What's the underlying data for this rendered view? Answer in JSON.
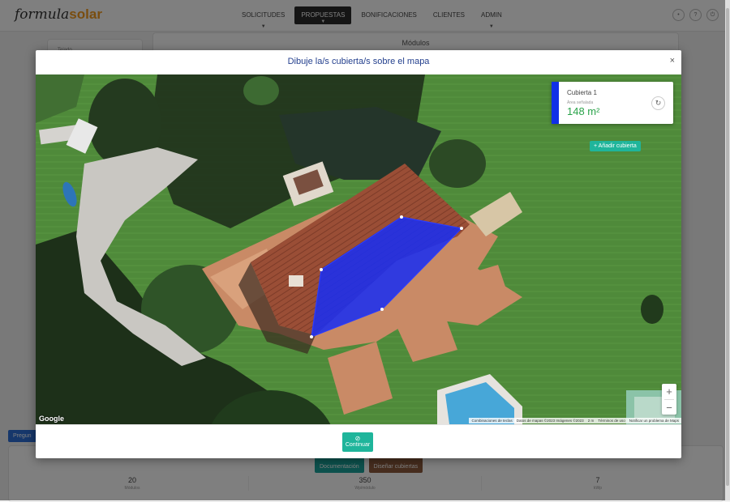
{
  "app": {
    "logo_part1": "formula",
    "logo_part2": "solar"
  },
  "nav": {
    "items": [
      {
        "label": "SOLICITUDES"
      },
      {
        "label": "PROPUESTAS"
      },
      {
        "label": "BONIFICACIONES"
      },
      {
        "label": "CLIENTES"
      },
      {
        "label": "ADMIN"
      }
    ]
  },
  "top_icons": {
    "bell": "bell-icon",
    "help": "?",
    "power": "power-icon"
  },
  "background": {
    "left_card_label": "Tejado",
    "main_card_title": "Módulos",
    "pregunta_label": "Pregun",
    "documentacion_label": "Documentación",
    "disenar_label": "Diseñar cubiertas",
    "stats": [
      {
        "value": "20",
        "unit": "Módulos"
      },
      {
        "value": "350",
        "unit": "Wp/módulo"
      },
      {
        "value": "7",
        "unit": "kWp"
      }
    ]
  },
  "modal": {
    "title": "Dibuje la/s cubierta/s sobre el mapa",
    "close_label": "×",
    "roof_card": {
      "name": "Cubierta 1",
      "area_label": "Área señalada",
      "area_value": "148 m²",
      "accent_color": "#1030e6"
    },
    "add_roof_label": "+ Añadir cubierta",
    "zoom_in": "+",
    "zoom_out": "−",
    "google_label": "Google",
    "attribution": [
      "Combinaciones de teclas",
      "Datos de mapas ©2023 Imágenes ©2023",
      "2 m",
      "Términos de uso",
      "Notificar un problema de Maps"
    ],
    "continue_label": "Continuar",
    "polygon_color": "#1a2ff0"
  }
}
